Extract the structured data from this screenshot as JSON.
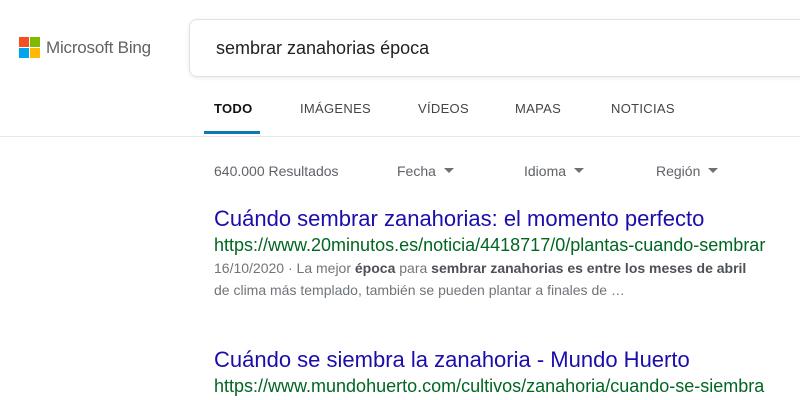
{
  "brand": {
    "name": "Microsoft Bing",
    "logo_colors": [
      "#f25022",
      "#7fba00",
      "#00a4ef",
      "#ffb900"
    ]
  },
  "search": {
    "query": "sembrar zanahorias época"
  },
  "tabs": [
    {
      "label": "TODO",
      "active": true
    },
    {
      "label": "IMÁGENES",
      "active": false
    },
    {
      "label": "VÍDEOS",
      "active": false
    },
    {
      "label": "MAPAS",
      "active": false
    },
    {
      "label": "NOTICIAS",
      "active": false
    }
  ],
  "filters": {
    "results_count": "640.000 Resultados",
    "date": "Fecha",
    "language": "Idioma",
    "region": "Región"
  },
  "results": [
    {
      "title": "Cuándo sembrar zanahorias: el momento perfecto",
      "url": "https://www.20minutos.es/noticia/4418717/0/plantas-cuando-sembrar",
      "date": "16/10/2020",
      "snippet_sep": " · ",
      "snippet_1": "La mejor ",
      "snippet_bold_1": "época",
      "snippet_2": " para ",
      "snippet_bold_2": "sembrar zanahorias es entre los meses de abril",
      "snippet_line2": "de clima más templado, también se pueden plantar a finales de …"
    },
    {
      "title": "Cuándo se siembra la zanahoria - Mundo Huerto",
      "url": "https://www.mundohuerto.com/cultivos/zanahoria/cuando-se-siembra"
    }
  ],
  "colors": {
    "link": "#1a0dab",
    "url": "#006621",
    "accent": "#0c7bb3"
  }
}
